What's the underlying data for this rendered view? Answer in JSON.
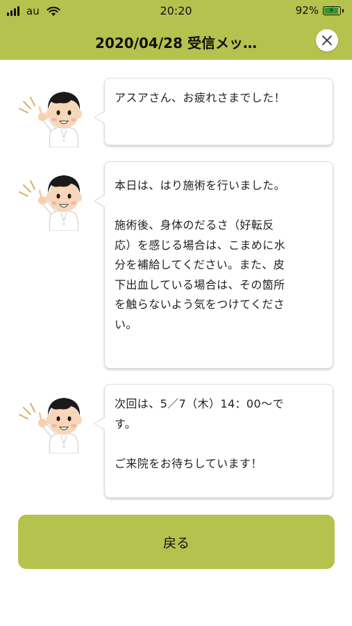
{
  "status_bar": {
    "carrier": "au",
    "time": "20:20",
    "battery": "92%",
    "battery_level": 0.92,
    "battery_color": "#2f9b2c"
  },
  "header": {
    "title": "2020/04/28 受信メッ…",
    "bg_color": "#b5c24e"
  },
  "close_icon": "close-icon",
  "messages": [
    {
      "lines": [
        "アスアさん、お疲れさまでした！"
      ]
    },
    {
      "paragraph1": "本日は、はり施術を行いました。",
      "paragraph2": "施術後、身体のだるさ（好転反\n応）を感じる場合は、こまめに水\n分を補給してください。また、皮\n下出血している場合は、その箇所\nを触らないよう気をつけてくださ\nい。"
    },
    {
      "paragraph1": "次回は、5／7（木）14：00〜で\nす。",
      "paragraph2": "ご来院をお待ちしています！"
    }
  ],
  "back_button": {
    "label": "戻る"
  }
}
